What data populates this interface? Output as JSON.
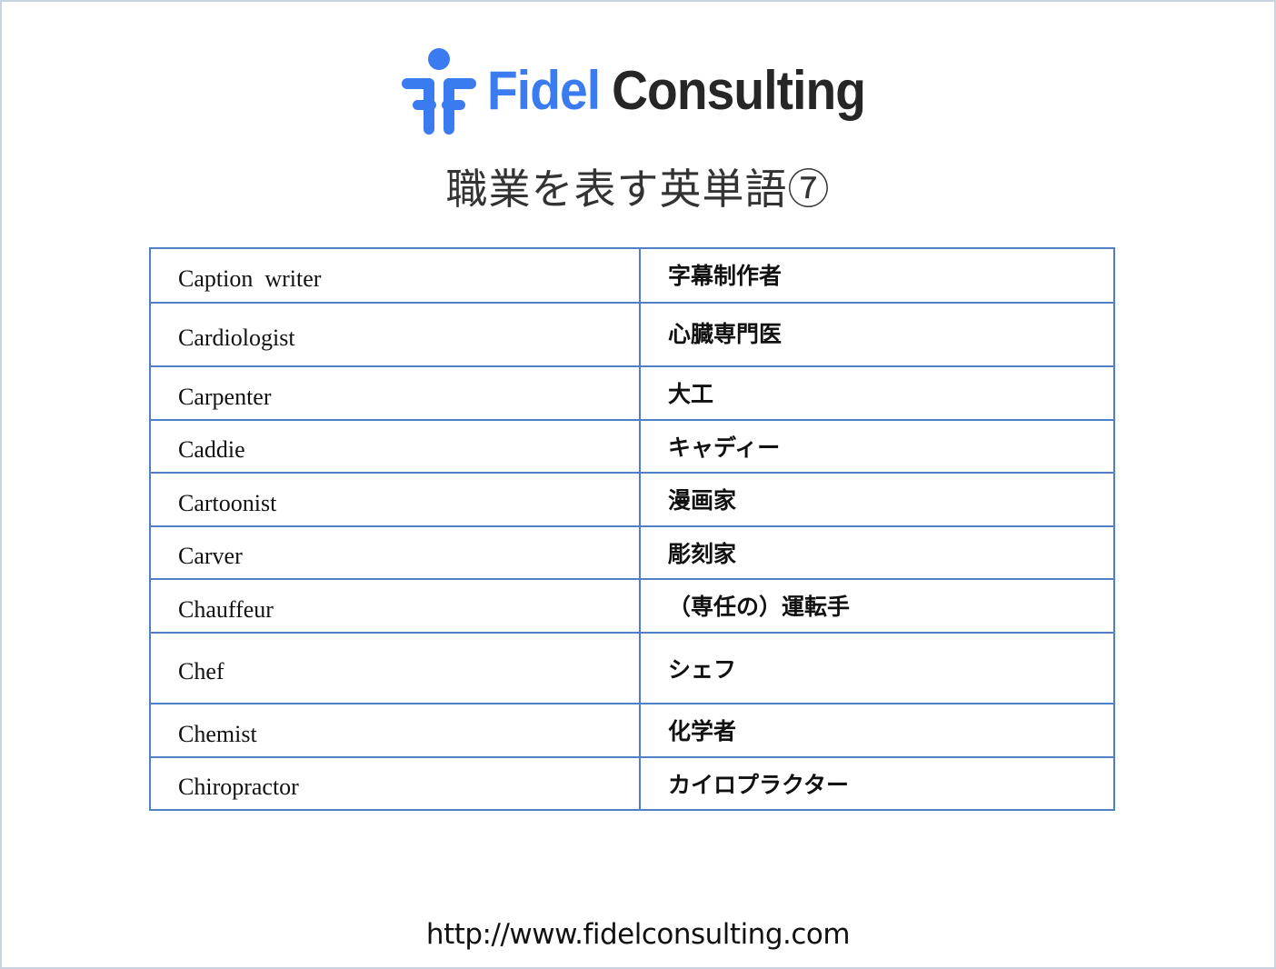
{
  "logo": {
    "icon": "fidel-person-icon",
    "brand_first": "Fidel",
    "brand_second": "Consulting",
    "brand_color": "#3b7bf0"
  },
  "title": "職業を表す英単語⑦",
  "vocabulary": [
    {
      "english": "Caption  writer",
      "japanese": "字幕制作者"
    },
    {
      "english": "Cardiologist",
      "japanese": "心臓専門医"
    },
    {
      "english": "Carpenter",
      "japanese": "大工"
    },
    {
      "english": "Caddie",
      "japanese": "キャディー"
    },
    {
      "english": "Cartoonist",
      "japanese": "漫画家"
    },
    {
      "english": "Carver",
      "japanese": "彫刻家"
    },
    {
      "english": "Chauffeur",
      "japanese": "（専任の）運転手"
    },
    {
      "english": "Chef",
      "japanese": "シェフ"
    },
    {
      "english": "Chemist",
      "japanese": "化学者"
    },
    {
      "english": "Chiropractor",
      "japanese": "カイロプラクター"
    }
  ],
  "footer_url": "http://www.fidelconsulting.com",
  "colors": {
    "table_border": "#4f7fc4",
    "page_border": "#c9d3e0"
  }
}
